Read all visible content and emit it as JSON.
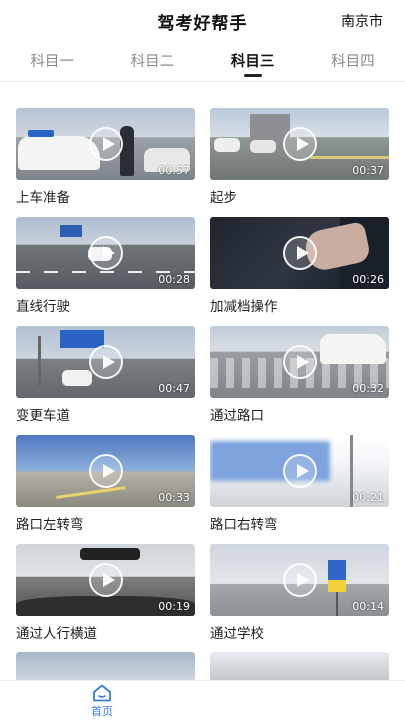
{
  "header": {
    "title": "驾考好帮手",
    "city": "南京市"
  },
  "tabs": [
    {
      "label": "科目一",
      "active": false
    },
    {
      "label": "科目二",
      "active": false
    },
    {
      "label": "科目三",
      "active": true
    },
    {
      "label": "科目四",
      "active": false
    }
  ],
  "videos": [
    {
      "title": "上车准备",
      "duration": "00:57"
    },
    {
      "title": "起步",
      "duration": "00:37"
    },
    {
      "title": "直线行驶",
      "duration": "00:28"
    },
    {
      "title": "加减档操作",
      "duration": "00:26"
    },
    {
      "title": "变更车道",
      "duration": "00:47"
    },
    {
      "title": "通过路口",
      "duration": "00:32"
    },
    {
      "title": "路口左转弯",
      "duration": "00:33"
    },
    {
      "title": "路口右转弯",
      "duration": "00:21"
    },
    {
      "title": "通过人行横道",
      "duration": "00:19"
    },
    {
      "title": "通过学校",
      "duration": "00:14"
    }
  ],
  "bottom_nav": {
    "home_label": "首页",
    "home_icon": "home-icon",
    "accent": "#3a7bd5"
  }
}
